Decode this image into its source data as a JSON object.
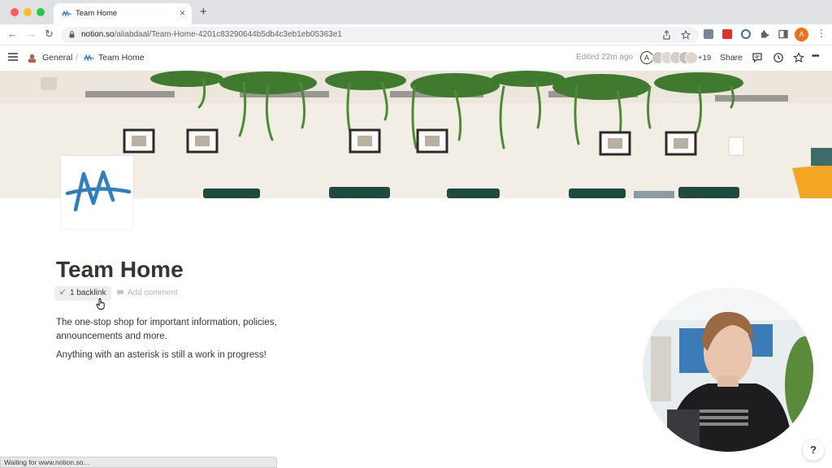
{
  "browser": {
    "tab_title": "Team Home",
    "tab_close": "×",
    "new_tab": "+",
    "back": "←",
    "forward": "→",
    "reload": "↻",
    "url_domain": "notion.so",
    "url_path": "/aliabdaal/Team-Home-4201c83290644b5db4c3eb1eb05363e1",
    "profile_initial": "A",
    "menu": "⋮",
    "status_text": "Waiting for www.notion.so..."
  },
  "topbar": {
    "menu_icon": "hamburger-icon",
    "breadcrumb": [
      "General",
      "Team Home"
    ],
    "separator": "/",
    "edited": "Edited 22m ago",
    "avatar_initial": "A",
    "extra_collaborators": "+19",
    "share": "Share",
    "more": "•••"
  },
  "page": {
    "title": "Team Home",
    "backlink_arrow": "↙",
    "backlink": "1 backlink",
    "add_comment": "Add comment",
    "paragraphs": [
      "The one-stop shop for important information, policies, announcements and more.",
      "Anything with an asterisk is still a work in progress!"
    ]
  },
  "help_label": "?",
  "colors": {
    "accent_blue": "#2f7fbf",
    "text": "#37352f",
    "muted": "#9b9a97",
    "profile": "#e8711c"
  }
}
